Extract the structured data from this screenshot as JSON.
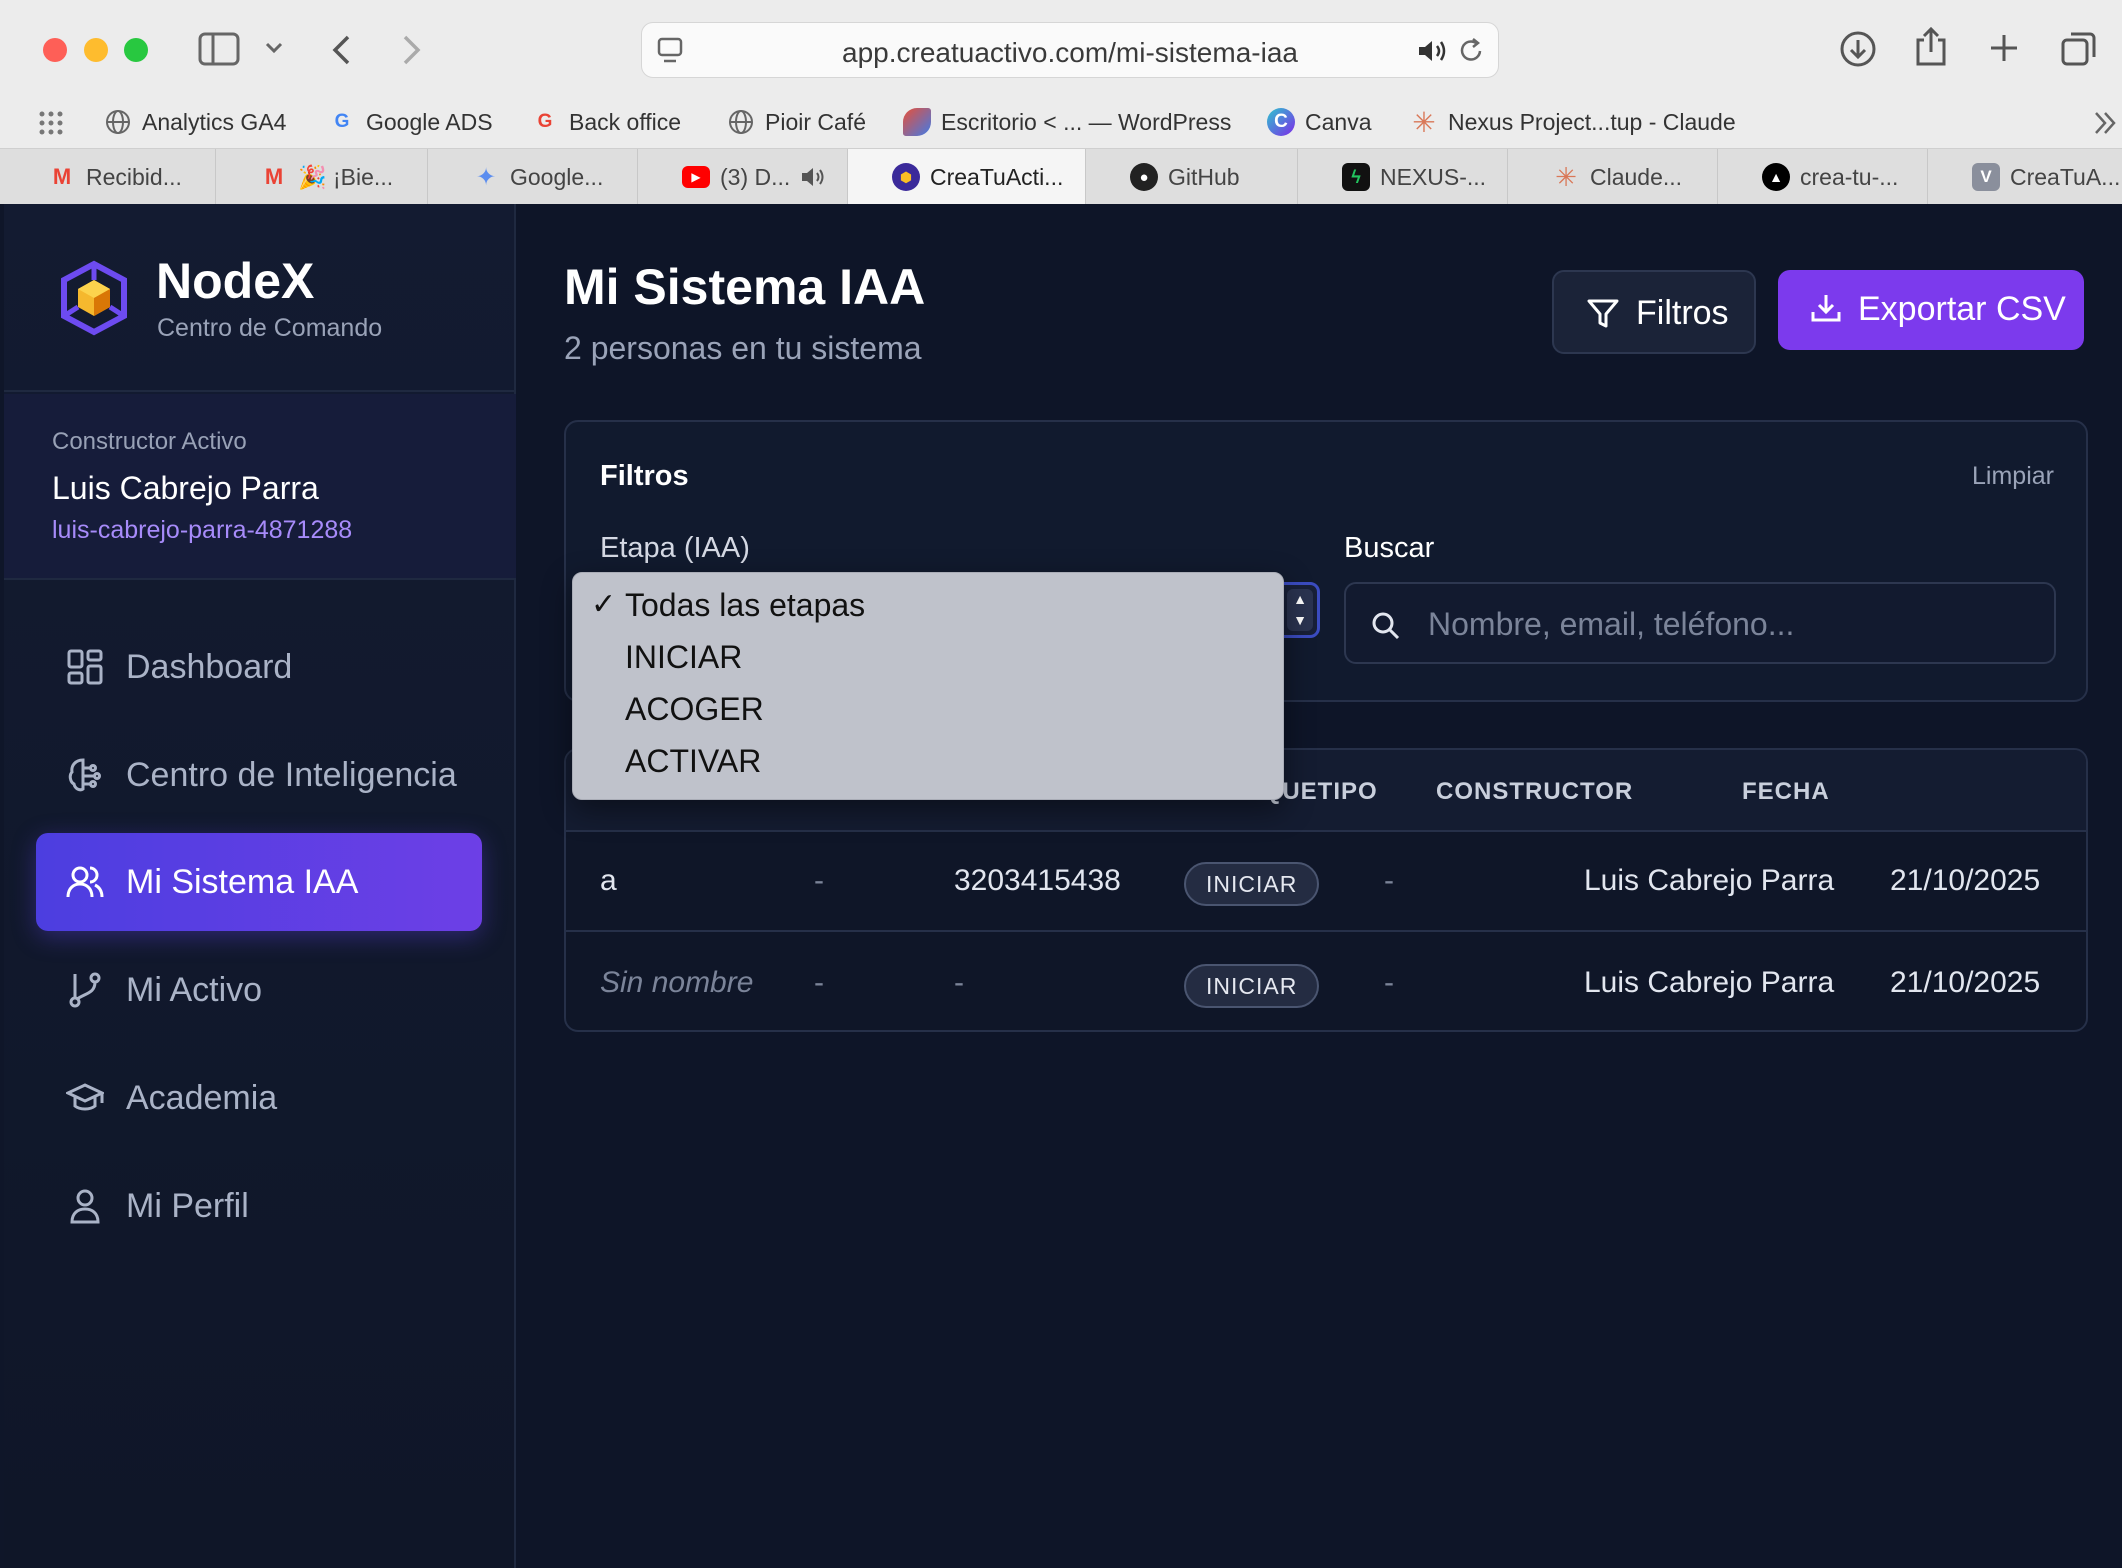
{
  "browser": {
    "url": "app.creatuactivo.com/mi-sistema-iaa",
    "bookmarks": [
      {
        "label": "Analytics GA4",
        "icon": "globe-icon"
      },
      {
        "label": "Google ADS",
        "icon": "google-icon"
      },
      {
        "label": "Back office",
        "icon": "google-icon"
      },
      {
        "label": "Pioir Café",
        "icon": "globe-icon"
      },
      {
        "label": "Escritorio < ... — WordPress",
        "icon": "wordpress-icon"
      },
      {
        "label": "Canva",
        "icon": "canva-icon"
      },
      {
        "label": "Nexus Project...tup - Claude",
        "icon": "claude-icon"
      }
    ],
    "tabs": [
      {
        "label": "Recibid...",
        "icon": "gmail-icon"
      },
      {
        "label": "🎉 ¡Bie...",
        "icon": "gmail-icon"
      },
      {
        "label": "Google...",
        "icon": "gemini-icon"
      },
      {
        "label": "(3) D...",
        "icon": "youtube-icon"
      },
      {
        "label": "CreaTuActi...",
        "icon": "nodex-icon",
        "active": true
      },
      {
        "label": "GitHub",
        "icon": "github-icon"
      },
      {
        "label": "NEXUS-...",
        "icon": "nexus-icon"
      },
      {
        "label": "Claude...",
        "icon": "claude-icon"
      },
      {
        "label": "crea-tu-...",
        "icon": "vercel-icon"
      },
      {
        "label": "CreaTuA...",
        "icon": "v-icon"
      }
    ]
  },
  "sidebar": {
    "brand_name": "NodeX",
    "brand_sub": "Centro de Comando",
    "builder_label": "Constructor Activo",
    "builder_name": "Luis Cabrejo Parra",
    "builder_slug": "luis-cabrejo-parra-4871288",
    "items": [
      {
        "label": "Dashboard",
        "icon": "dashboard-grid-icon"
      },
      {
        "label": "Centro de Inteligencia",
        "icon": "brain-icon"
      },
      {
        "label": "Mi Sistema IAA",
        "icon": "users-icon",
        "active": true
      },
      {
        "label": "Mi Activo",
        "icon": "branch-icon"
      },
      {
        "label": "Academia",
        "icon": "graduation-cap-icon"
      },
      {
        "label": "Mi Perfil",
        "icon": "user-icon"
      }
    ]
  },
  "header": {
    "title": "Mi Sistema IAA",
    "subtitle": "2 personas en tu sistema",
    "filter_button": "Filtros",
    "export_button": "Exportar CSV"
  },
  "filters": {
    "title": "Filtros",
    "clear": "Limpiar",
    "stage_label": "Etapa (IAA)",
    "search_label": "Buscar",
    "search_placeholder": "Nombre, email, teléfono...",
    "stage_options": [
      "Todas las etapas",
      "INICIAR",
      "ACOGER",
      "ACTIVAR"
    ],
    "stage_selected": "Todas las etapas"
  },
  "table": {
    "headers": [
      "ARQUETIPO",
      "CONSTRUCTOR",
      "FECHA"
    ],
    "rows": [
      {
        "name": "a",
        "email": "-",
        "phone": "3203415438",
        "stage": "INICIAR",
        "archetype": "-",
        "builder": "Luis Cabrejo Parra",
        "date": "21/10/2025"
      },
      {
        "name": "Sin nombre",
        "email": "-",
        "phone": "-",
        "stage": "INICIAR",
        "archetype": "-",
        "builder": "Luis Cabrejo Parra",
        "date": "21/10/2025"
      }
    ]
  },
  "colors": {
    "accent": "#7c3aed",
    "nav_active": "#5b3fe3",
    "background": "#0e1528"
  }
}
